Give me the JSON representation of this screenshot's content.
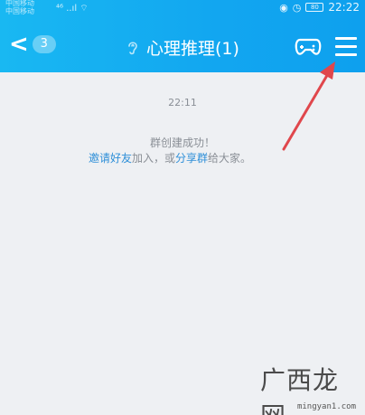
{
  "status_bar": {
    "carrier_1": "中国移动",
    "carrier_2": "中国移动",
    "signal": "⁴⁶ ..ıl ⌔",
    "battery": "80",
    "time": "22:22"
  },
  "header": {
    "back_badge": "3",
    "title": "心理推理(1)",
    "icons": [
      "back-chevron-icon",
      "ear-icon",
      "gamepad-icon",
      "menu-icon"
    ]
  },
  "chat": {
    "timestamp": "22:11",
    "system_line1": "群创建成功！",
    "invite_link": "邀请好友",
    "text_mid": "加入，或",
    "share_link": "分享群",
    "text_end": "给大家。"
  },
  "watermark": {
    "logo_text": "广西龙网",
    "url": "mingyan1.com"
  },
  "colors": {
    "header_bg": "#12a6f0",
    "chat_bg": "#eef0f3",
    "link": "#2e8fd8",
    "arrow": "#e0474c"
  }
}
